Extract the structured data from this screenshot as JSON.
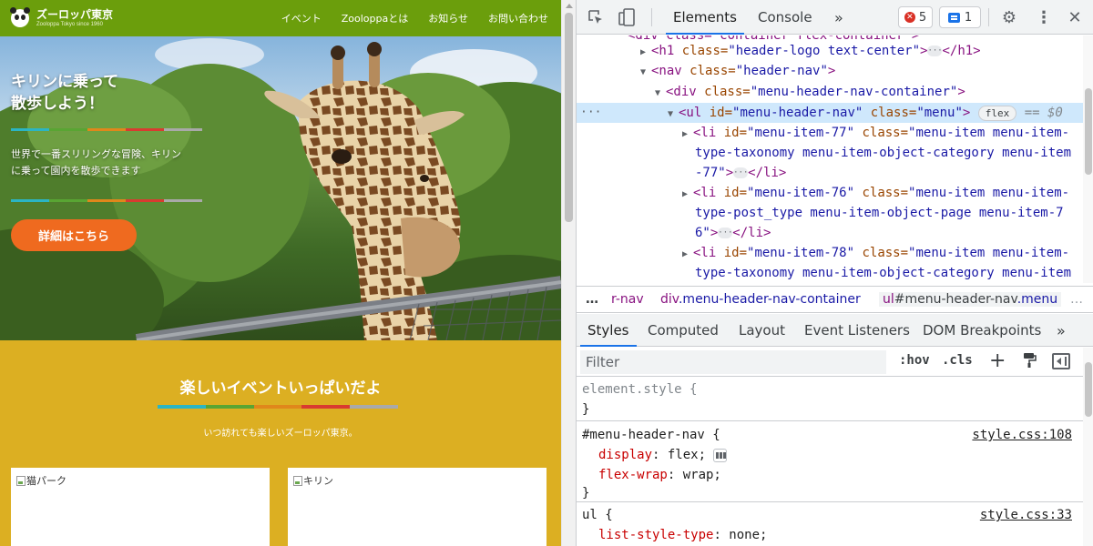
{
  "site": {
    "logo": {
      "name": "ズーロッパ東京",
      "tagline": "Zooloppa Tokyo since 1960"
    },
    "nav": [
      "イベント",
      "Zooloppaとは",
      "お知らせ",
      "お問い合わせ"
    ],
    "hero": {
      "title": "キリンに乗って\n散歩しよう！",
      "text": "世界で一番スリリングな冒険、キリン\nに乗って園内を散歩できます",
      "button": "詳細はこちら"
    },
    "stripe_colors": [
      "#2bb5c4",
      "#59a533",
      "#e0871b",
      "#d93b30",
      "#a9a9a9"
    ],
    "events": {
      "title": "楽しいイベントいっぱいだよ",
      "subtitle": "いつ訪れても楽しいズーロッパ東京。",
      "cards": [
        {
          "alt": "猫パーク"
        },
        {
          "alt": "キリン"
        }
      ]
    },
    "colors": {
      "header": "#6b9e0c",
      "events_bg": "#dcaf22",
      "button": "#ef6a1f"
    }
  },
  "devtools": {
    "tabs": {
      "elements": "Elements",
      "console": "Console",
      "more": "»"
    },
    "error_count": "5",
    "message_count": "1",
    "dom": {
      "line0": {
        "text": "<div class=\"container flex-container\">"
      },
      "line1": {
        "tag_open": "<h1",
        "attr": " class=",
        "val": "\"header-logo text-center\"",
        "close": ">",
        "end": "</h1>"
      },
      "line2": {
        "tag_open": "<nav",
        "attr": " class=",
        "val": "\"header-nav\"",
        "close": ">"
      },
      "line3": {
        "tag_open": "<div",
        "attr": " class=",
        "val": "\"menu-header-nav-container\"",
        "close": ">"
      },
      "line4": {
        "tag_open": "<ul",
        "attr1": " id=",
        "val1": "\"menu-header-nav\"",
        "attr2": " class=",
        "val2": "\"menu\"",
        "close": ">",
        "badge": "flex",
        "eq": "== $0"
      },
      "items": [
        {
          "id": "\"menu-item-77\"",
          "line_a": "\"menu-item menu-item-",
          "line_b": "type-taxonomy menu-item-object-category menu-item",
          "line_c": "-77\""
        },
        {
          "id": "\"menu-item-76\"",
          "line_a": "\"menu-item menu-item-",
          "line_b": "type-post_type menu-item-object-page menu-item-7",
          "line_c": "6\""
        },
        {
          "id": "\"menu-item-78\"",
          "line_a": "\"menu-item menu-item-",
          "line_b": "type-taxonomy menu-item-object-category menu-item",
          "line_c": ""
        }
      ]
    },
    "breadcrumbs": {
      "more": "…",
      "c1": "r-nav",
      "c2_tag": "div",
      "c2_cls": ".menu-header-nav-container",
      "c3_tag": "ul",
      "c3_id": "#menu-header-nav",
      "c3_cls": ".menu",
      "more_r": "…"
    },
    "subtabs": {
      "styles": "Styles",
      "computed": "Computed",
      "layout": "Layout",
      "listeners": "Event Listeners",
      "dom": "DOM Breakpoints",
      "more": "»"
    },
    "filter": {
      "placeholder": "Filter",
      "hov": ":hov",
      "cls": ".cls",
      "add": "+"
    },
    "rules": {
      "element": {
        "selector": "element.style {",
        "close": "}"
      },
      "menu": {
        "selector": "#menu-header-nav {",
        "src": "style.css:108",
        "p1": "display",
        "v1": "flex;",
        "p2": "flex-wrap",
        "v2": "wrap;",
        "close": "}"
      },
      "ul": {
        "selector": "ul {",
        "src": "style.css:33",
        "p1": "list-style-type",
        "v1": "none;"
      }
    }
  }
}
